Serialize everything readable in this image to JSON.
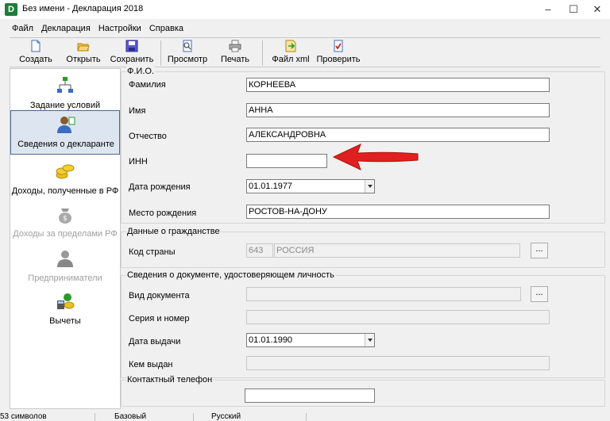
{
  "window": {
    "title": "Без имени - Декларация 2018",
    "app_icon_letter": "D"
  },
  "menu": [
    "Файл",
    "Декларация",
    "Настройки",
    "Справка"
  ],
  "toolbar": {
    "create": "Создать",
    "open": "Открыть",
    "save": "Сохранить",
    "preview": "Просмотр",
    "print": "Печать",
    "xml": "Файл xml",
    "check": "Проверить"
  },
  "sidebar": {
    "items": [
      {
        "label": "Задание условий",
        "icon": "conditions-icon",
        "disabled": false
      },
      {
        "label": "Сведения о декларанте",
        "icon": "declarant-icon",
        "disabled": false
      },
      {
        "label": "Доходы, полученные в РФ",
        "icon": "income-rf-icon",
        "disabled": false
      },
      {
        "label": "Доходы за пределами РФ",
        "icon": "income-abroad-icon",
        "disabled": true
      },
      {
        "label": "Предприниматели",
        "icon": "entrepreneurs-icon",
        "disabled": true
      },
      {
        "label": "Вычеты",
        "icon": "deductions-icon",
        "disabled": false
      }
    ]
  },
  "fio": {
    "title": "Ф.И.О.",
    "surname_label": "Фамилия",
    "surname": "КОРНЕЕВА",
    "name_label": "Имя",
    "name": "АННА",
    "patronymic_label": "Отчество",
    "patronymic": "АЛЕКСАНДРОВНА",
    "inn_label": "ИНН",
    "inn": "",
    "birthdate_label": "Дата рождения",
    "birthdate": "01.01.1977",
    "birthplace_label": "Место рождения",
    "birthplace": "РОСТОВ-НА-ДОНУ"
  },
  "citizenship": {
    "title": "Данные о гражданстве",
    "country_label": "Код страны",
    "country_code": "643",
    "country_name": "РОССИЯ",
    "browse": "..."
  },
  "document": {
    "title": "Сведения о документе, удостоверяющем личность",
    "type_label": "Вид документа",
    "type": "",
    "browse": "...",
    "series_label": "Серия и номер",
    "series": "",
    "issue_date_label": "Дата выдачи",
    "issue_date": "01.01.1990",
    "issued_by_label": "Кем выдан",
    "issued_by": ""
  },
  "phone": {
    "title": "Контактный телефон",
    "value": ""
  },
  "status": {
    "chars": "53 символов",
    "mode": "Базовый",
    "lang": "Русский"
  },
  "colors": {
    "arrow": "#e02020",
    "sidebar_active": "#dde6f0",
    "app_icon": "#1e7d3a"
  }
}
